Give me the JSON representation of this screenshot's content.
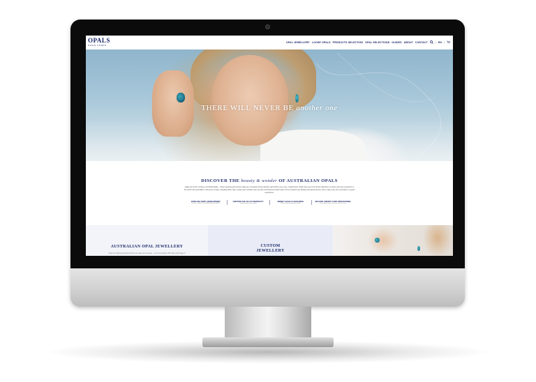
{
  "nav": {
    "logo": {
      "main": "OPALS",
      "sub": "DOWN UNDER"
    },
    "links": [
      "OPAL JEWELLERY",
      "LOOSE OPALS",
      "PRODUCTS SELECTION",
      "OPAL SELECTIONS",
      "GUIDES",
      "ABOUT",
      "CONTACT"
    ],
    "icons": [
      "search-icon",
      "account-icon",
      "cart-icon"
    ],
    "lang": "EN"
  },
  "hero": {
    "tagline_lead": "THERE WILL NEVER BE",
    "tagline_em": "another one"
  },
  "discover": {
    "title_lead": "DISCOVER THE",
    "title_em": "beauty & wonder",
    "title_tail": "OF AUSTRALIAN OPALS",
    "body": "Opals are fresh, exciting, and fashionable – these amazing gemstones really are a timeless living rainbow right before your eyes. Opals Down Under has one of the finest selections of opals you'll see anywhere in the world. We specialise in all types of opal, including white opal, crystal opal, boulder opal, and the world famous black opal. All our products are backed with good service. All to make sure your purchase is a good experience.",
    "features": [
      {
        "title": "FREE DELIVERY WORLDWIDE*",
        "sub": "Free on orders over $150 Delivered. AUD*"
      },
      {
        "title": "CERTIFICATE OF AUTHENTICITY",
        "sub": "Included with every order"
      },
      {
        "title": "MONEY BACK GUARANTEE",
        "sub": "30 day money back guarantee"
      },
      {
        "title": "SECURE CREDIT CARD PROCESSING",
        "sub": "Pay safely using a secure SSL service"
      }
    ]
  },
  "cards": {
    "jewellery": {
      "title": "AUSTRALIAN OPAL JEWELLERY",
      "sub": "Opal is an alluring gemstone that is as unique as its wearer – so is our jewellery. We have a full range of"
    },
    "custom": {
      "title_line1": "CUSTOM",
      "title_line2": "JEWELLERY"
    }
  },
  "colors": {
    "brand_navy": "#1d2a6b",
    "bezel": "#0b0b0c",
    "aluminium": "#c9c9c9"
  }
}
